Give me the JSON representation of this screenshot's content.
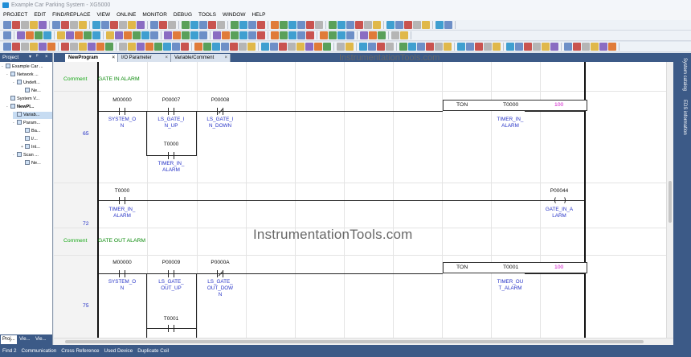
{
  "window": {
    "title": "Example Car Parking System - XG5000"
  },
  "menu": [
    "PROJECT",
    "EDIT",
    "FIND/REPLACE",
    "VIEW",
    "ONLINE",
    "MONITOR",
    "DEBUG",
    "TOOLS",
    "WINDOW",
    "HELP"
  ],
  "watermark": "InstrumentationTools.com",
  "project_panel": {
    "title": "Project",
    "controls": [
      "▾",
      "ᴾ",
      "×"
    ],
    "tree": [
      {
        "label": "Example Car ...",
        "toggle": "-"
      },
      {
        "label": "Network ...",
        "toggle": "-"
      },
      {
        "label": "Undefi...",
        "toggle": "-"
      },
      {
        "label": "Ne...",
        "toggle": ""
      },
      {
        "label": "System V...",
        "toggle": ""
      },
      {
        "label": "NewPl...",
        "toggle": "-"
      },
      {
        "label": "Variab...",
        "toggle": ""
      },
      {
        "label": "Param...",
        "toggle": "-"
      },
      {
        "label": "Ba...",
        "toggle": ""
      },
      {
        "label": "I/...",
        "toggle": ""
      },
      {
        "label": "Int...",
        "toggle": "+"
      },
      {
        "label": "Scan ...",
        "toggle": "-"
      },
      {
        "label": "Ne...",
        "toggle": ""
      }
    ],
    "tabs": [
      "Proj...",
      "Vie...",
      "Vie..."
    ]
  },
  "doc_tabs": [
    "NewProgram",
    "I/O Parameter",
    "Variable/Comment"
  ],
  "doc_tab_close": "×",
  "right_tabs": [
    "System catalog",
    "EDS information"
  ],
  "status_tabs": [
    "Find 2",
    "Communication",
    "Cross Reference",
    "Used Device",
    "Duplicate Coil"
  ],
  "ladder": {
    "comment_label": "Comment",
    "comment1": "GATE IN ALARM",
    "comment2": "GATE OUT ALARM",
    "rungs": [
      {
        "number": "65",
        "contacts": [
          {
            "addr": "M00000",
            "device": "SYSTEM_O N",
            "nc": false
          },
          {
            "addr": "P00007",
            "device": "LS_GATE_I N_UP",
            "nc": false
          },
          {
            "addr": "P00008",
            "device": "LS_GATE_I N_DOWN",
            "nc": true
          },
          {
            "addr": "T0000",
            "device": "TIMER_IN_ ALARM",
            "nc": false
          }
        ],
        "fblock": {
          "name": "TON",
          "param": "T0000",
          "value": "100",
          "device": "TIMER_IN_ ALARM"
        }
      },
      {
        "number": "72",
        "contacts": [
          {
            "addr": "T0000",
            "device": "TIMER_IN_ ALARM",
            "nc": false
          }
        ],
        "coil": {
          "addr": "P00044",
          "device": "GATE_IN_A LARM"
        }
      },
      {
        "number": "75",
        "contacts": [
          {
            "addr": "M00000",
            "device": "SYSTEM_O N",
            "nc": false
          },
          {
            "addr": "P00009",
            "device": "LS_GATE_ OUT_UP",
            "nc": false
          },
          {
            "addr": "P0000A",
            "device": "LS_GATE_ OUT_DOW N",
            "nc": true
          },
          {
            "addr": "T0001",
            "device": "",
            "nc": false
          }
        ],
        "fblock": {
          "name": "TON",
          "param": "T0001",
          "value": "100",
          "device": "TIMER_OU T_ALARM"
        }
      }
    ]
  }
}
